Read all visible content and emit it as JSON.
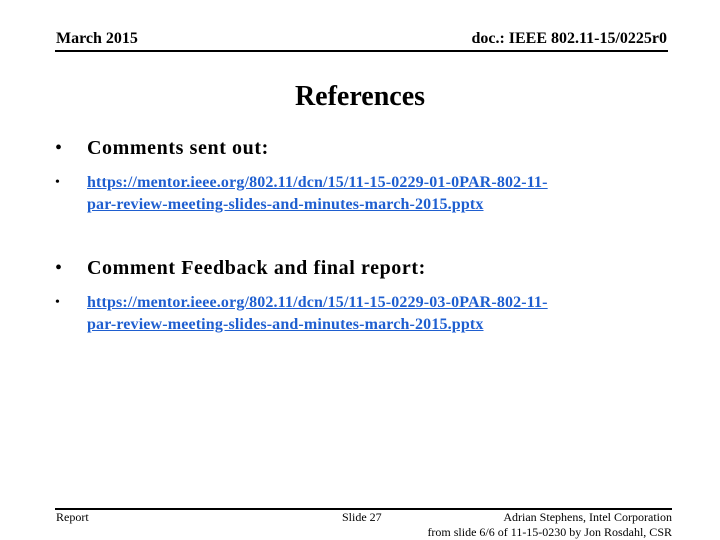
{
  "header": {
    "date": "March 2015",
    "doc_id": "doc.: IEEE 802.11-15/0225r0"
  },
  "title": "References",
  "sections": [
    {
      "heading": "Comments sent out:",
      "link": "https://mentor.ieee.org/802.11/dcn/15/11-15-0229-01-0PAR-802-11-par-review-meeting-slides-and-minutes-march-2015.pptx",
      "link_line1": "https://mentor.ieee.org/802.11/dcn/15/11-15-0229-01-0PAR-802-11-",
      "link_line2": "par-review-meeting-slides-and-minutes-march-2015.pptx"
    },
    {
      "heading": "Comment Feedback and final report:",
      "link": "https://mentor.ieee.org/802.11/dcn/15/11-15-0229-03-0PAR-802-11-par-review-meeting-slides-and-minutes-march-2015.pptx",
      "link_line1": "https://mentor.ieee.org/802.11/dcn/15/11-15-0229-03-0PAR-802-11-",
      "link_line2": "par-review-meeting-slides-and-minutes-march-2015.pptx"
    }
  ],
  "bullet_glyph": "•",
  "footer": {
    "left": "Report",
    "slide": "Slide 27",
    "author": "Adrian Stephens, Intel Corporation",
    "source": "from slide 6/6 of 11-15-0230 by Jon Rosdahl, CSR"
  },
  "colors": {
    "link": "#1f5fd0",
    "text": "#000000",
    "background": "#ffffff"
  }
}
